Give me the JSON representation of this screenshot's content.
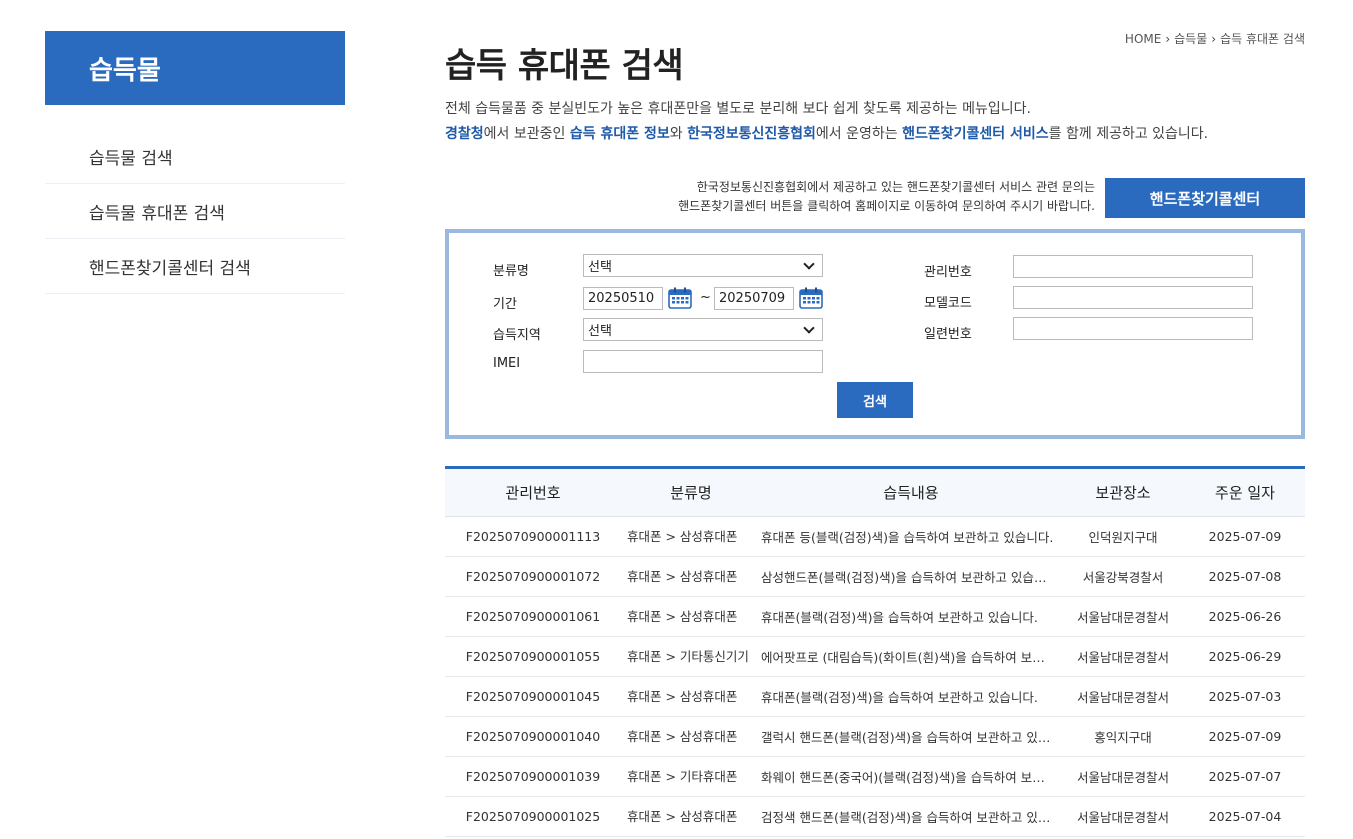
{
  "sidebar": {
    "title": "습득물",
    "items": [
      {
        "label": "습득물 검색"
      },
      {
        "label": "습득물 휴대폰 검색"
      },
      {
        "label": "핸드폰찾기콜센터 검색"
      }
    ]
  },
  "breadcrumb": {
    "home": "HOME",
    "level1": "습득물",
    "level2": "습득 휴대폰 검색"
  },
  "page": {
    "title": "습득 휴대폰 검색",
    "desc_line1": "전체 습득물품 중 분실빈도가 높은 휴대폰만을 별도로 분리해 보다 쉽게 찾도록 제공하는 메뉴입니다.",
    "desc_line2": {
      "p1": "경찰청",
      "p2": "에서 보관중인 ",
      "p3": "습득 휴대폰 정보",
      "p4": "와 ",
      "p5": "한국정보통신진흥협회",
      "p6": "에서 운영하는 ",
      "p7": "핸드폰찾기콜센터 서비스",
      "p8": "를 함께 제공하고 있습니다."
    }
  },
  "notice": {
    "line1": "한국정보통신진흥협회에서 제공하고 있는 핸드폰찾기콜센터 서비스 관련 문의는",
    "line2": "핸드폰찾기콜센터 버튼을 클릭하여 홈페이지로 이동하여 문의하여 주시기 바랍니다.",
    "button": "핸드폰찾기콜센터"
  },
  "search": {
    "category_label": "분류명",
    "category_value": "선택",
    "period_label": "기간",
    "date_from": "20250510",
    "date_sep": "~",
    "date_to": "20250709",
    "region_label": "습득지역",
    "region_value": "선택",
    "imei_label": "IMEI",
    "imei_value": "",
    "mgmt_label": "관리번호",
    "mgmt_value": "",
    "model_label": "모델코드",
    "model_value": "",
    "serial_label": "일련번호",
    "serial_value": "",
    "search_button": "검색"
  },
  "table": {
    "headers": [
      "관리번호",
      "분류명",
      "습득내용",
      "보관장소",
      "주운 일자"
    ],
    "rows": [
      {
        "id": "F2025070900001113",
        "category": "휴대폰 > 삼성휴대폰",
        "content": "휴대폰 등(블랙(검정)색)을 습득하여 보관하고 있습니다.",
        "place": "인덕원지구대",
        "date": "2025-07-09"
      },
      {
        "id": "F2025070900001072",
        "category": "휴대폰 > 삼성휴대폰",
        "content": "삼성핸드폰(블랙(검정)색)을 습득하여 보관하고 있습니다.",
        "place": "서울강북경찰서",
        "date": "2025-07-08"
      },
      {
        "id": "F2025070900001061",
        "category": "휴대폰 > 삼성휴대폰",
        "content": "휴대폰(블랙(검정)색)을 습득하여 보관하고 있습니다.",
        "place": "서울남대문경찰서",
        "date": "2025-06-26"
      },
      {
        "id": "F2025070900001055",
        "category": "휴대폰 > 기타통신기기",
        "content": "에어팟프로 (대림습득)(화이트(흰)색)을 습득하여 보관하고 있습니다.",
        "place": "서울남대문경찰서",
        "date": "2025-06-29"
      },
      {
        "id": "F2025070900001045",
        "category": "휴대폰 > 삼성휴대폰",
        "content": "휴대폰(블랙(검정)색)을 습득하여 보관하고 있습니다.",
        "place": "서울남대문경찰서",
        "date": "2025-07-03"
      },
      {
        "id": "F2025070900001040",
        "category": "휴대폰 > 삼성휴대폰",
        "content": "갤럭시 핸드폰(블랙(검정)색)을 습득하여 보관하고 있습니다.",
        "place": "홍익지구대",
        "date": "2025-07-09"
      },
      {
        "id": "F2025070900001039",
        "category": "휴대폰 > 기타휴대폰",
        "content": "화웨이 핸드폰(중국어)(블랙(검정)색)을 습득하여 보관하고 있습니다.",
        "place": "서울남대문경찰서",
        "date": "2025-07-07"
      },
      {
        "id": "F2025070900001025",
        "category": "휴대폰 > 삼성휴대폰",
        "content": "검정색 핸드폰(블랙(검정)색)을 습득하여 보관하고 있습니다.",
        "place": "서울남대문경찰서",
        "date": "2025-07-04"
      }
    ]
  },
  "colors": {
    "accent": "#2b6bbf",
    "highlight_text": "#1f5aa8",
    "search_border": "#9ab8e0"
  }
}
